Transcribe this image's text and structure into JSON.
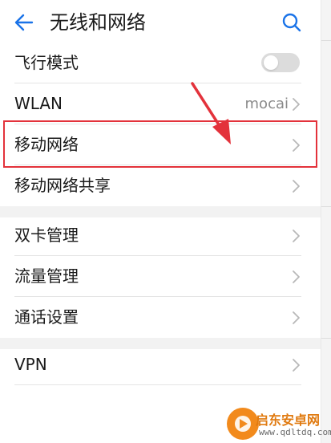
{
  "header": {
    "title": "无线和网络",
    "back_icon": "arrow-left-icon",
    "search_icon": "search-icon",
    "accent_color": "#1a73e8"
  },
  "rows": [
    {
      "label": "飞行模式",
      "control": "toggle",
      "toggle_on": false
    },
    {
      "label": "WLAN",
      "value": "mocai",
      "control": "chevron"
    },
    {
      "label": "移动网络",
      "control": "chevron",
      "highlighted": true
    },
    {
      "label": "移动网络共享",
      "control": "chevron"
    },
    {
      "label": "双卡管理",
      "control": "chevron"
    },
    {
      "label": "流量管理",
      "control": "chevron"
    },
    {
      "label": "通话设置",
      "control": "chevron"
    },
    {
      "label": "VPN",
      "control": "chevron"
    }
  ],
  "annotation": {
    "highlight_color": "#e3323b",
    "arrow_color": "#e3323b"
  },
  "watermark": {
    "title": "启东安卓网",
    "url": "www.qdltdq.com",
    "logo_color": "#f28a1c"
  }
}
